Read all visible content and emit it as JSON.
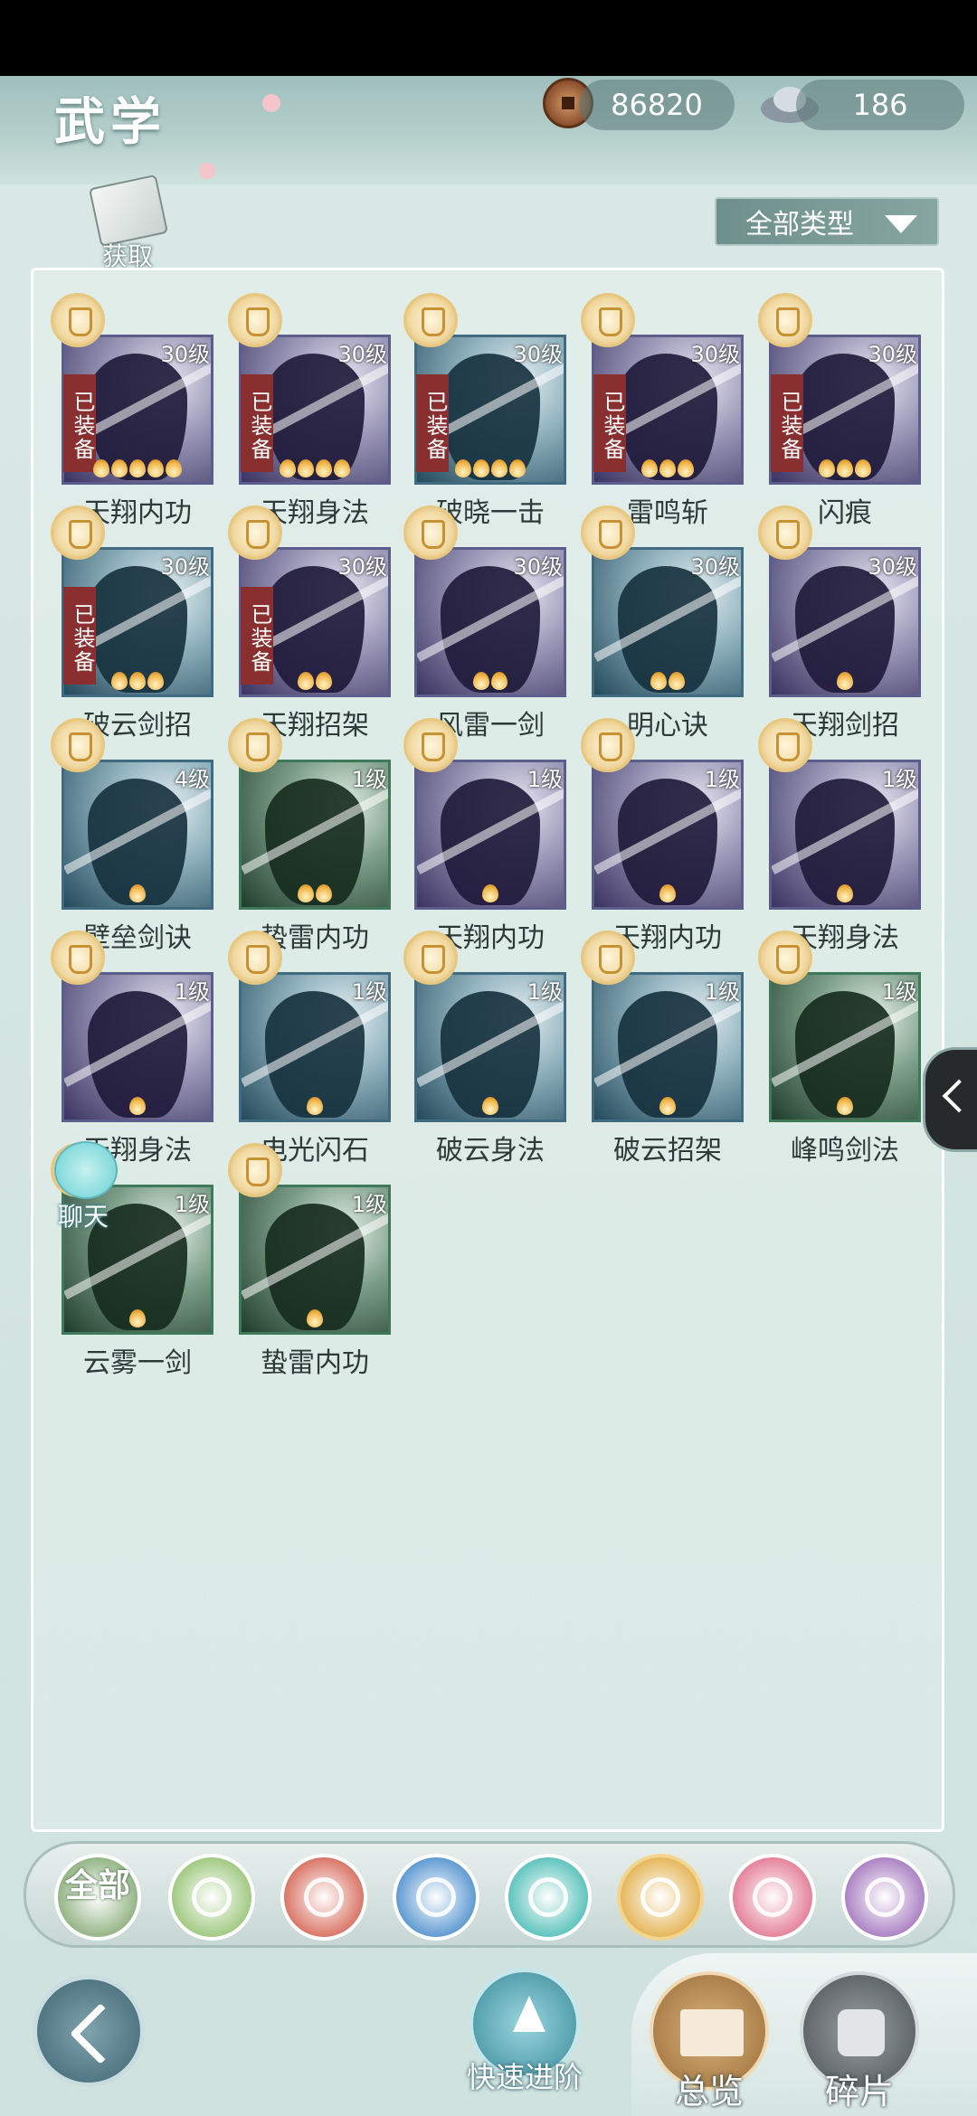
{
  "header": {
    "title": "武学"
  },
  "currency": {
    "copper": "86820",
    "silver": "186"
  },
  "obtain_label": "获取",
  "filter": {
    "selected": "全部类型"
  },
  "equipped_label": "已装备",
  "skills": [
    {
      "name": "天翔内功",
      "level": "30级",
      "stars": 5,
      "equipped": true,
      "color": "purple"
    },
    {
      "name": "天翔身法",
      "level": "30级",
      "stars": 4,
      "equipped": true,
      "color": "purple"
    },
    {
      "name": "破晓一击",
      "level": "30级",
      "stars": 4,
      "equipped": true,
      "color": "blue"
    },
    {
      "name": "雷鸣斩",
      "level": "30级",
      "stars": 3,
      "equipped": true,
      "color": "purple"
    },
    {
      "name": "闪痕",
      "level": "30级",
      "stars": 3,
      "equipped": true,
      "color": "purple"
    },
    {
      "name": "破云剑招",
      "level": "30级",
      "stars": 3,
      "equipped": true,
      "color": "blue"
    },
    {
      "name": "天翔招架",
      "level": "30级",
      "stars": 2,
      "equipped": true,
      "color": "purple"
    },
    {
      "name": "风雷一剑",
      "level": "30级",
      "stars": 2,
      "equipped": false,
      "color": "purple"
    },
    {
      "name": "明心诀",
      "level": "30级",
      "stars": 2,
      "equipped": false,
      "color": "blue"
    },
    {
      "name": "天翔剑招",
      "level": "30级",
      "stars": 1,
      "equipped": false,
      "color": "purple"
    },
    {
      "name": "壁垒剑诀",
      "level": "4级",
      "stars": 1,
      "equipped": false,
      "color": "blue"
    },
    {
      "name": "蛰雷内功",
      "level": "1级",
      "stars": 2,
      "equipped": false,
      "color": "green"
    },
    {
      "name": "天翔内功",
      "level": "1级",
      "stars": 1,
      "equipped": false,
      "color": "purple"
    },
    {
      "name": "天翔内功",
      "level": "1级",
      "stars": 1,
      "equipped": false,
      "color": "purple"
    },
    {
      "name": "天翔身法",
      "level": "1级",
      "stars": 1,
      "equipped": false,
      "color": "purple"
    },
    {
      "name": "天翔身法",
      "level": "1级",
      "stars": 1,
      "equipped": false,
      "color": "purple"
    },
    {
      "name": "电光闪石",
      "level": "1级",
      "stars": 1,
      "equipped": false,
      "color": "blue"
    },
    {
      "name": "破云身法",
      "level": "1级",
      "stars": 1,
      "equipped": false,
      "color": "blue"
    },
    {
      "name": "破云招架",
      "level": "1级",
      "stars": 1,
      "equipped": false,
      "color": "blue"
    },
    {
      "name": "峰鸣剑法",
      "level": "1级",
      "stars": 1,
      "equipped": false,
      "color": "green"
    },
    {
      "name": "云雾一剑",
      "level": "1级",
      "stars": 1,
      "equipped": false,
      "color": "green"
    },
    {
      "name": "蛰雷内功",
      "level": "1级",
      "stars": 1,
      "equipped": false,
      "color": "green"
    }
  ],
  "chat_label": "聊天",
  "category_filters": [
    {
      "name": "all",
      "label": "全部",
      "color": "#7fa66e"
    },
    {
      "name": "sword",
      "color": "#8fbf6a"
    },
    {
      "name": "fire",
      "color": "#d25a48"
    },
    {
      "name": "wave",
      "color": "#3f86c9"
    },
    {
      "name": "butterfly",
      "color": "#3fb8b0"
    },
    {
      "name": "shield",
      "color": "#e0a93c"
    },
    {
      "name": "moon",
      "color": "#e06a86"
    },
    {
      "name": "rose",
      "color": "#9b6ab8"
    }
  ],
  "bottom": {
    "quick_advance": "快速进阶",
    "overview": "总览",
    "fragments": "碎片"
  }
}
